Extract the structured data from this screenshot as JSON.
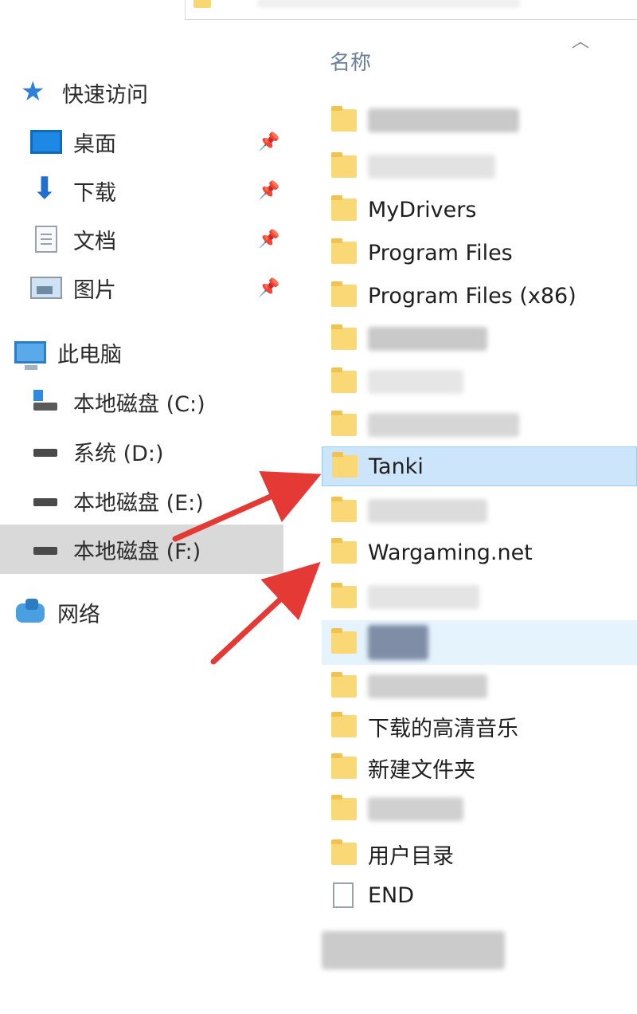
{
  "nav": {
    "quick_access": "快速访问",
    "items": [
      {
        "label": "桌面",
        "icon": "desktop-icon"
      },
      {
        "label": "下载",
        "icon": "download-icon"
      },
      {
        "label": "文档",
        "icon": "document-icon"
      },
      {
        "label": "图片",
        "icon": "pictures-icon"
      }
    ],
    "this_pc": "此电脑",
    "drives": [
      {
        "label": "本地磁盘 (C:)"
      },
      {
        "label": "系统 (D:)"
      },
      {
        "label": "本地磁盘 (E:)"
      },
      {
        "label": "本地磁盘 (F:)"
      }
    ],
    "network": "网络"
  },
  "list": {
    "column_header": "名称",
    "rows": [
      {
        "label": "MyDrivers"
      },
      {
        "label": "Program Files"
      },
      {
        "label": "Program Files (x86)"
      },
      {
        "label": "Tanki"
      },
      {
        "label": "Wargaming.net"
      },
      {
        "label": "下载的高清音乐"
      },
      {
        "label": "新建文件夹"
      },
      {
        "label": "用户目录"
      },
      {
        "label": "END"
      }
    ]
  },
  "colors": {
    "selection": "#cce5fa",
    "folder": "#fbd876",
    "arrow": "#e53935",
    "header_text": "#6b7f99"
  }
}
